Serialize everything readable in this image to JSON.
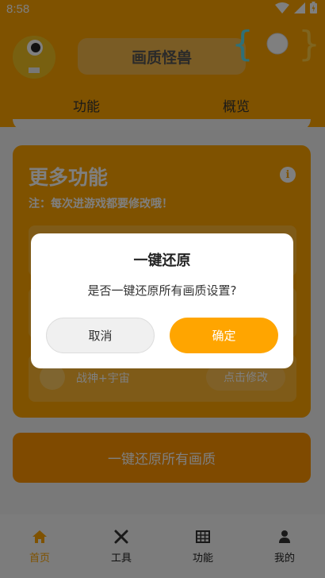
{
  "status": {
    "time": "8:58"
  },
  "header": {
    "title": "画质怪兽",
    "tabs": [
      "功能",
      "概览"
    ]
  },
  "card": {
    "title": "更多功能",
    "note": "注：每次进游戏都要修改哦！",
    "row_label": "战神+宇宙",
    "row_button": "点击修改"
  },
  "restore_button": "一键还原所有画质",
  "bottom_nav": {
    "items": [
      {
        "label": "首页",
        "icon": "home-icon",
        "active": true
      },
      {
        "label": "工具",
        "icon": "tools-icon",
        "active": false
      },
      {
        "label": "功能",
        "icon": "grid-icon",
        "active": false
      },
      {
        "label": "我的",
        "icon": "user-icon",
        "active": false
      }
    ]
  },
  "dialog": {
    "title": "一键还原",
    "message": "是否一键还原所有画质设置?",
    "cancel_label": "取消",
    "ok_label": "确定"
  },
  "colors": {
    "accent": "#ffa500",
    "toggle_bracket": "#5ee0f0"
  }
}
